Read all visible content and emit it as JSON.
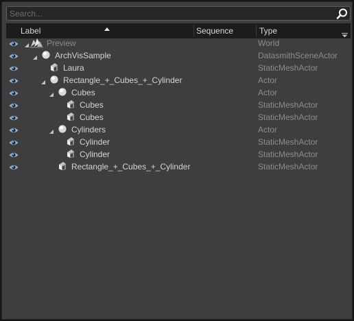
{
  "search": {
    "placeholder": "Search..."
  },
  "columns": {
    "label": "Label",
    "sequence": "Sequence",
    "type": "Type"
  },
  "rows": [
    {
      "label": "Preview",
      "type": "World"
    },
    {
      "label": "ArchVisSample",
      "type": "DatasmithSceneActor"
    },
    {
      "label": "Laura",
      "type": "StaticMeshActor"
    },
    {
      "label": "Rectangle_+_Cubes_+_Cylinder",
      "type": "Actor"
    },
    {
      "label": "Cubes",
      "type": "Actor"
    },
    {
      "label": "Cubes",
      "type": "StaticMeshActor"
    },
    {
      "label": "Cubes",
      "type": "StaticMeshActor"
    },
    {
      "label": "Cylinders",
      "type": "Actor"
    },
    {
      "label": "Cylinder",
      "type": "StaticMeshActor"
    },
    {
      "label": "Cylinder",
      "type": "StaticMeshActor"
    },
    {
      "label": "Rectangle_+_Cubes_+_Cylinder",
      "type": "StaticMeshActor"
    }
  ],
  "icons": {
    "visibility": "eye-icon",
    "world": "world-icon",
    "actor": "sphere-icon",
    "static_mesh": "static-mesh-icon",
    "expanded": "triangle-expanded-icon",
    "search": "magnifier-icon",
    "sort": "sort-ascending-icon",
    "dropdown": "dropdown-arrow-icon"
  },
  "colors": {
    "panel_bg": "#3e3e3e",
    "header_bg": "#1c1c1c",
    "search_bg": "#262626",
    "eye_blue": "#8fb2d6",
    "type_text": "#8c8c8c"
  }
}
